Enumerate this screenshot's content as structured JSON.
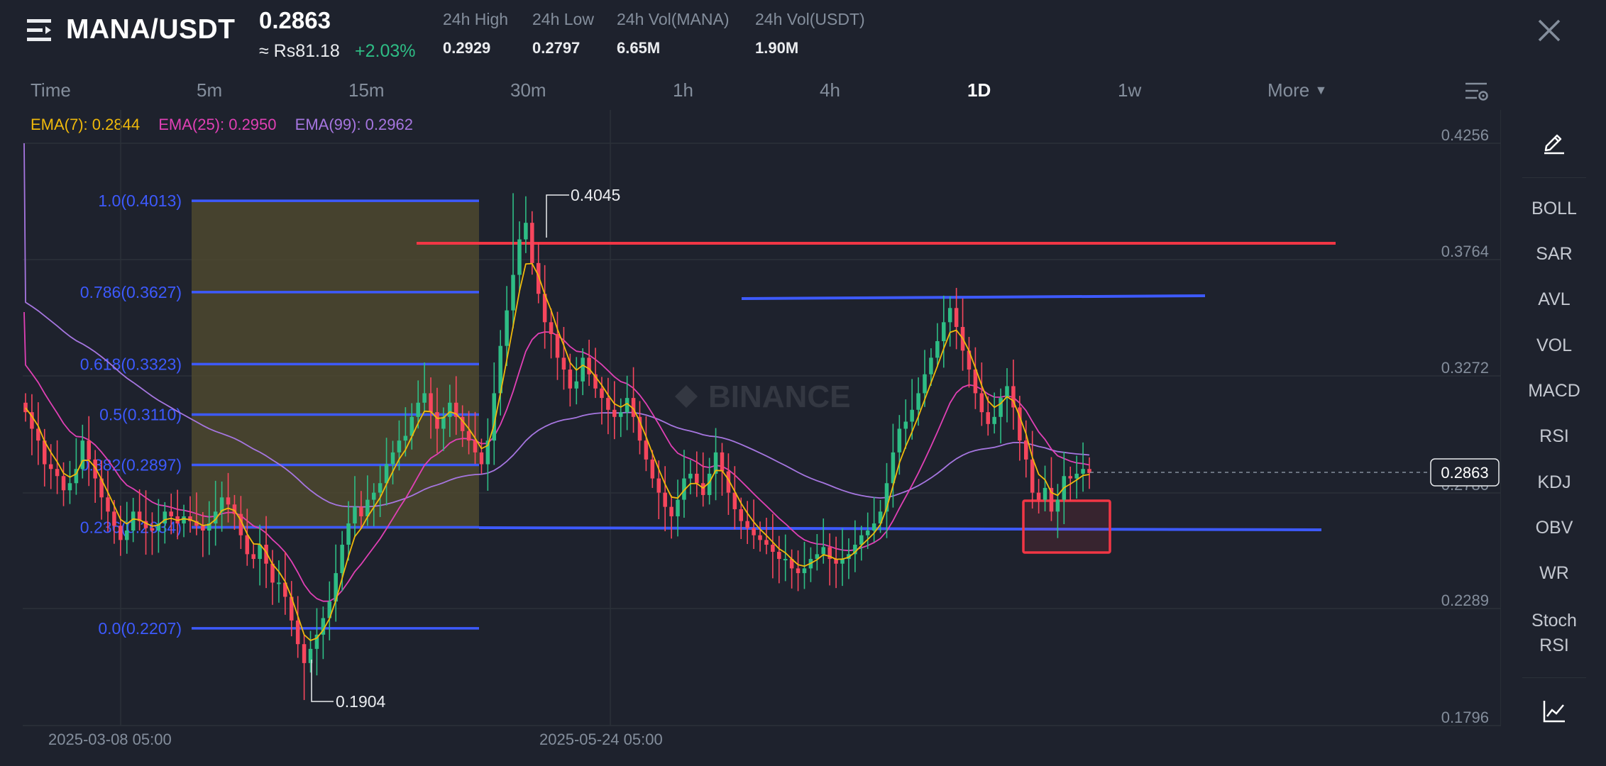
{
  "header": {
    "pair": "MANA/USDT",
    "price": "0.2863",
    "fiat": "≈ Rs81.18",
    "change": "+2.03%",
    "stats": [
      {
        "label": "24h High",
        "value": "0.2929"
      },
      {
        "label": "24h Low",
        "value": "0.2797"
      },
      {
        "label": "24h Vol(MANA)",
        "value": "6.65M"
      },
      {
        "label": "24h Vol(USDT)",
        "value": "1.90M"
      }
    ]
  },
  "timeframes": [
    "Time",
    "5m",
    "15m",
    "30m",
    "1h",
    "4h",
    "1D",
    "1w",
    "More"
  ],
  "active_timeframe": "1D",
  "ema": {
    "ema7": "EMA(7): 0.2844",
    "ema25": "EMA(25): 0.2950",
    "ema99": "EMA(99): 0.2962"
  },
  "sidebar": [
    "BOLL",
    "SAR",
    "AVL",
    "VOL",
    "MACD",
    "RSI",
    "KDJ",
    "OBV",
    "WR",
    "Stoch RSI"
  ],
  "icons": {
    "menu": "menu-icon",
    "close": "close-icon",
    "settings": "chart-settings-icon",
    "draw": "pencil-icon",
    "indicator": "line-chart-icon"
  },
  "colors": {
    "up": "#2ebd85",
    "down": "#f6465d",
    "ema7": "#f0b90b",
    "ema25": "#e040b5",
    "ema99": "#a676e0",
    "fib": "#3d5afe",
    "resistance": "#f23645"
  },
  "chart_data": {
    "type": "candlestick",
    "watermark": "BINANCE",
    "price_axis": [
      "0.4256",
      "0.3764",
      "0.3272",
      "0.2780",
      "0.2289",
      "0.1796"
    ],
    "last_price": "0.2863",
    "x_labels": [
      "2025-03-08 05:00",
      "2025-05-24 05:00"
    ],
    "high_marker": "0.4045",
    "low_marker": "0.1904",
    "fibonacci": [
      {
        "label": "1.0(0.4013)",
        "price": 0.4013
      },
      {
        "label": "0.786(0.3627)",
        "price": 0.3627
      },
      {
        "label": "0.618(0.3323)",
        "price": 0.3323
      },
      {
        "label": "0.5(0.3110)",
        "price": 0.311
      },
      {
        "label": "0.382(0.2897)",
        "price": 0.2897
      },
      {
        "label": "0.236(0.2634)",
        "price": 0.2634
      },
      {
        "label": "0.0(0.2207)",
        "price": 0.2207
      }
    ],
    "close_series": [
      0.312,
      0.305,
      0.3,
      0.29,
      0.288,
      0.285,
      0.279,
      0.282,
      0.288,
      0.3,
      0.292,
      0.284,
      0.276,
      0.27,
      0.264,
      0.258,
      0.262,
      0.27,
      0.266,
      0.263,
      0.262,
      0.265,
      0.27,
      0.268,
      0.265,
      0.268,
      0.266,
      0.264,
      0.262,
      0.265,
      0.27,
      0.276,
      0.273,
      0.269,
      0.26,
      0.252,
      0.25,
      0.256,
      0.248,
      0.24,
      0.24,
      0.234,
      0.224,
      0.214,
      0.206,
      0.212,
      0.218,
      0.225,
      0.232,
      0.244,
      0.256,
      0.265,
      0.272,
      0.268,
      0.275,
      0.278,
      0.282,
      0.29,
      0.295,
      0.3,
      0.302,
      0.31,
      0.316,
      0.32,
      0.312,
      0.305,
      0.31,
      0.316,
      0.31,
      0.304,
      0.3,
      0.295,
      0.29,
      0.3,
      0.32,
      0.34,
      0.355,
      0.37,
      0.385,
      0.392,
      0.375,
      0.362,
      0.35,
      0.345,
      0.335,
      0.33,
      0.322,
      0.325,
      0.335,
      0.328,
      0.322,
      0.318,
      0.313,
      0.31,
      0.312,
      0.318,
      0.31,
      0.3,
      0.292,
      0.284,
      0.278,
      0.272,
      0.268,
      0.275,
      0.284,
      0.286,
      0.282,
      0.277,
      0.286,
      0.295,
      0.287,
      0.278,
      0.271,
      0.266,
      0.263,
      0.26,
      0.258,
      0.256,
      0.253,
      0.25,
      0.25,
      0.246,
      0.244,
      0.246,
      0.25,
      0.252,
      0.255,
      0.25,
      0.248,
      0.25,
      0.252,
      0.256,
      0.26,
      0.262,
      0.265,
      0.27,
      0.282,
      0.295,
      0.305,
      0.308,
      0.313,
      0.32,
      0.328,
      0.335,
      0.342,
      0.35,
      0.356,
      0.348,
      0.338,
      0.33,
      0.32,
      0.312,
      0.307,
      0.31,
      0.318,
      0.323,
      0.314,
      0.3,
      0.292,
      0.278,
      0.275,
      0.28,
      0.27,
      0.275,
      0.285,
      0.284,
      0.286,
      0.288,
      0.2863
    ]
  }
}
